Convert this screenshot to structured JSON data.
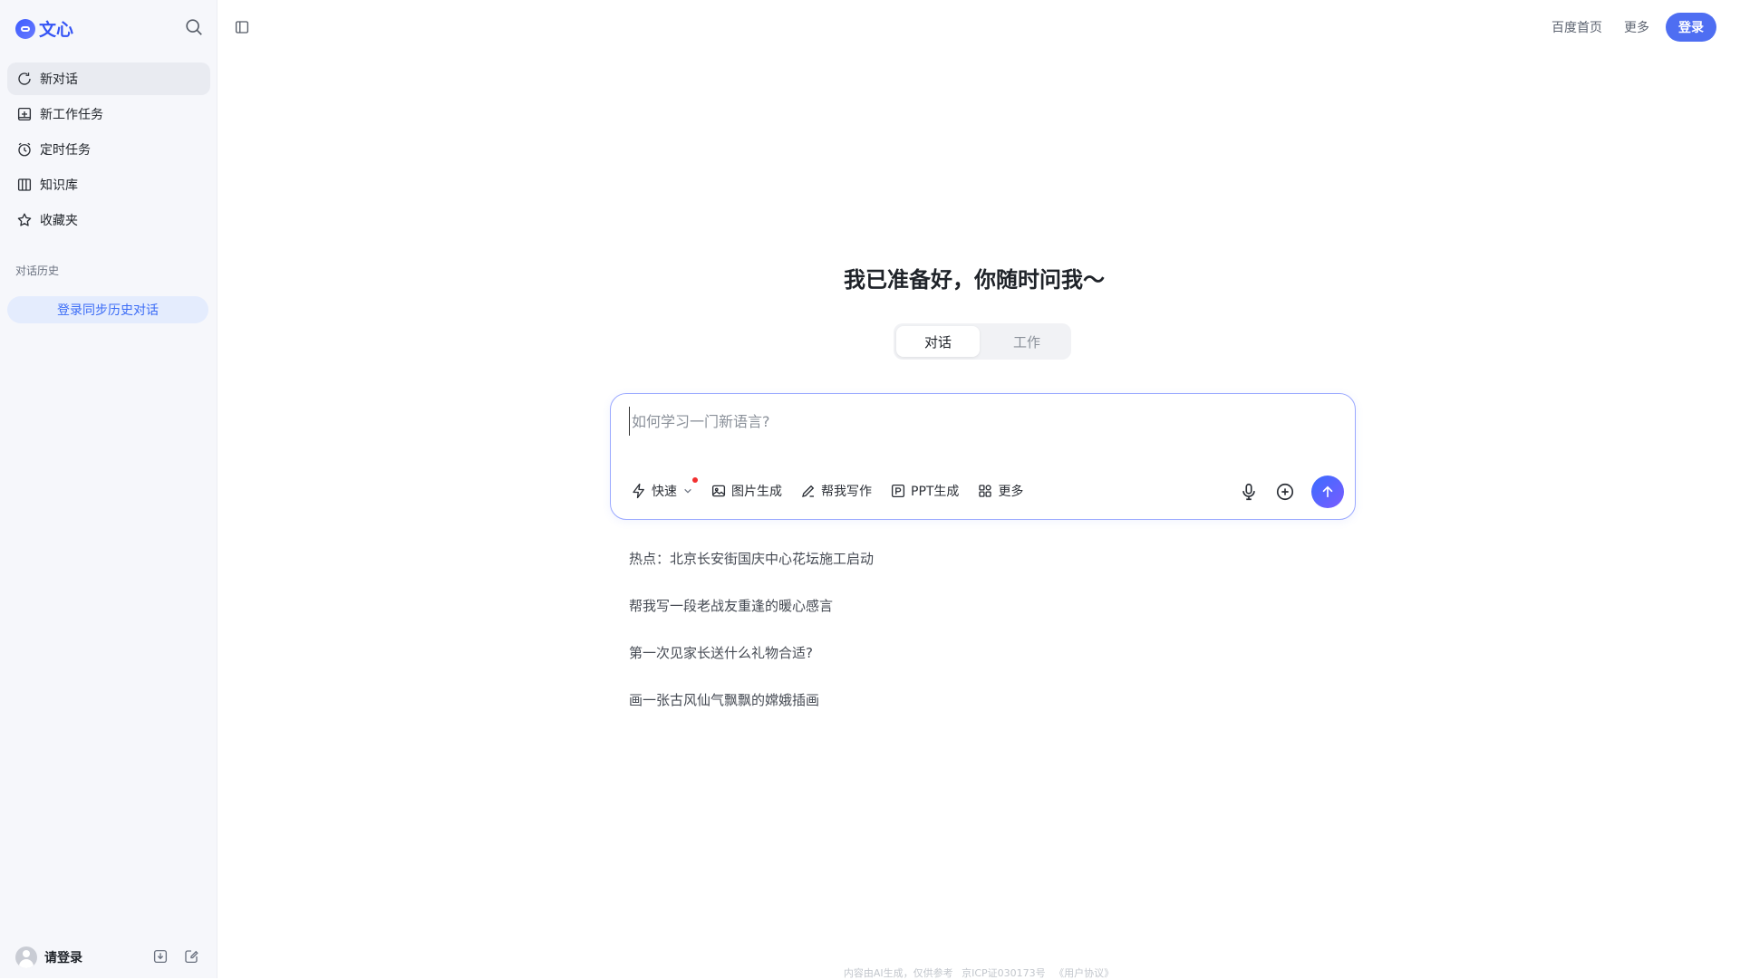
{
  "app": {
    "name": "文心"
  },
  "sidebar": {
    "items": [
      {
        "label": "新对话",
        "icon": "new-chat-icon"
      },
      {
        "label": "新工作任务",
        "icon": "new-task-icon"
      },
      {
        "label": "定时任务",
        "icon": "alarm-clock-icon"
      },
      {
        "label": "知识库",
        "icon": "library-icon"
      },
      {
        "label": "收藏夹",
        "icon": "star-icon"
      }
    ],
    "history_title": "对话历史",
    "sync_button": "登录同步历史对话",
    "login_prompt": "请登录"
  },
  "header": {
    "links": [
      "百度首页",
      "更多"
    ],
    "login_button": "登录"
  },
  "main": {
    "headline": "我已准备好，你随时问我～",
    "tabs": [
      {
        "label": "对话",
        "active": true
      },
      {
        "label": "工作",
        "active": false
      }
    ],
    "input_placeholder": "如何学习一门新语言?",
    "tools": [
      {
        "label": "快速",
        "icon": "lightning-icon"
      },
      {
        "label": "图片生成",
        "icon": "image-icon"
      },
      {
        "label": "帮我写作",
        "icon": "pen-icon"
      },
      {
        "label": "PPT生成",
        "icon": "ppt-icon"
      },
      {
        "label": "更多",
        "icon": "grid-icon"
      }
    ],
    "suggestions": [
      "热点：北京长安街国庆中心花坛施工启动",
      "帮我写一段老战友重逢的暖心感言",
      "第一次见家长送什么礼物合适?",
      "画一张古风仙气飘飘的嫦娥插画"
    ]
  },
  "footer": {
    "notice": "内容由AI生成，仅供参考",
    "icp": "京ICP证030173号",
    "agreement": "《用户协议》"
  },
  "colors": {
    "accent": "#4e6ef2",
    "sidebar_bg": "#f6f7fb",
    "sync_text": "#3b6cf6"
  }
}
